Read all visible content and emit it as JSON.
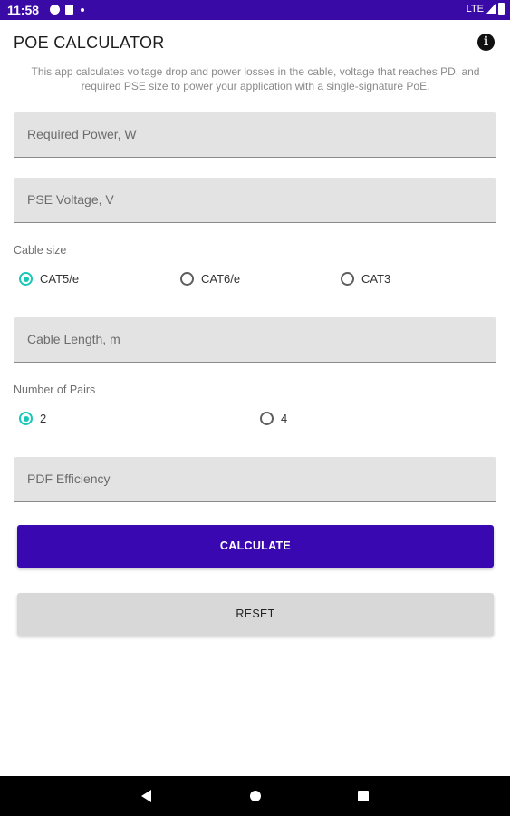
{
  "status_bar": {
    "time": "11:58",
    "network": "LTE"
  },
  "app": {
    "title": "POE CALCULATOR",
    "description": "This app calculates voltage drop and power losses in the cable, voltage that reaches PD, and required PSE size to power your application with a single-signature PoE."
  },
  "fields": {
    "required_power": {
      "placeholder": "Required Power, W",
      "value": ""
    },
    "pse_voltage": {
      "placeholder": "PSE Voltage, V",
      "value": ""
    },
    "cable_length": {
      "placeholder": "Cable Length, m",
      "value": ""
    },
    "pdf_efficiency": {
      "placeholder": "PDF Efficiency",
      "value": ""
    }
  },
  "cable_size": {
    "label": "Cable size",
    "options": [
      "CAT5/e",
      "CAT6/e",
      "CAT3"
    ],
    "selected": "CAT5/e"
  },
  "pairs": {
    "label": "Number of Pairs",
    "options": [
      "2",
      "4"
    ],
    "selected": "2"
  },
  "buttons": {
    "calculate": "CALCULATE",
    "reset": "RESET"
  },
  "colors": {
    "status_bar": "#3a0aa6",
    "primary_button": "#3a08b1",
    "radio_accent": "#19c7b8"
  }
}
